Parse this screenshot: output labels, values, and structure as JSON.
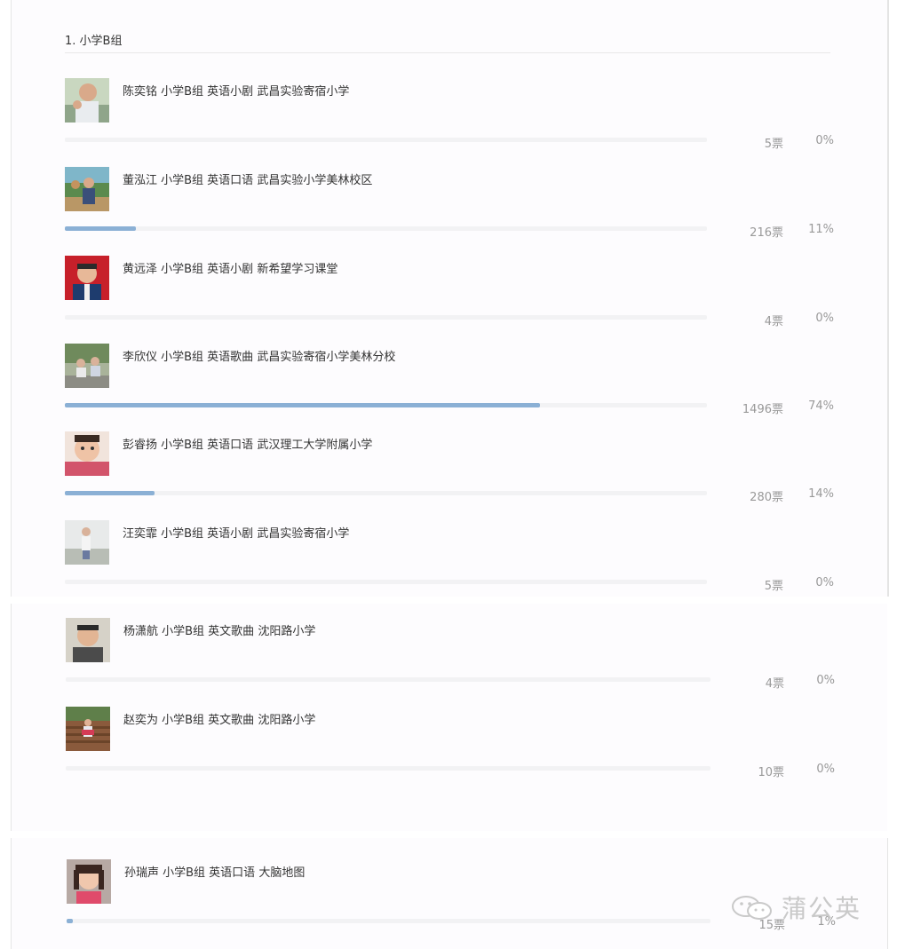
{
  "group_title": "1. 小学B组",
  "accent_color": "#8bb0d5",
  "candidates": [
    {
      "name": "陈奕铭 小学B组 英语小剧 武昌实验寄宿小学",
      "votes": "5票",
      "percent": "0%",
      "fill": 0.0
    },
    {
      "name": "董泓江 小学B组 英语口语 武昌实验小学美林校区",
      "votes": "216票",
      "percent": "11%",
      "fill": 0.11
    },
    {
      "name": "黄远泽 小学B组 英语小剧 新希望学习课堂",
      "votes": "4票",
      "percent": "0%",
      "fill": 0.0
    },
    {
      "name": "李欣仪 小学B组 英语歌曲 武昌实验寄宿小学美林分校",
      "votes": "1496票",
      "percent": "74%",
      "fill": 0.74
    },
    {
      "name": "彭睿扬 小学B组 英语口语 武汉理工大学附属小学",
      "votes": "280票",
      "percent": "14%",
      "fill": 0.14
    },
    {
      "name": "汪奕霏 小学B组 英语小剧 武昌实验寄宿小学",
      "votes": "5票",
      "percent": "0%",
      "fill": 0.0
    },
    {
      "name": "杨潇航 小学B组 英文歌曲 沈阳路小学",
      "votes": "4票",
      "percent": "0%",
      "fill": 0.0
    },
    {
      "name": "赵奕为 小学B组 英文歌曲 沈阳路小学",
      "votes": "10票",
      "percent": "0%",
      "fill": 0.0
    },
    {
      "name": "孙瑞声 小学B组 英语口语 大脑地图",
      "votes": "15票",
      "percent": "1%",
      "fill": 0.01
    }
  ],
  "watermark": {
    "text": "蒲公英",
    "icon": "wechat-icon"
  }
}
